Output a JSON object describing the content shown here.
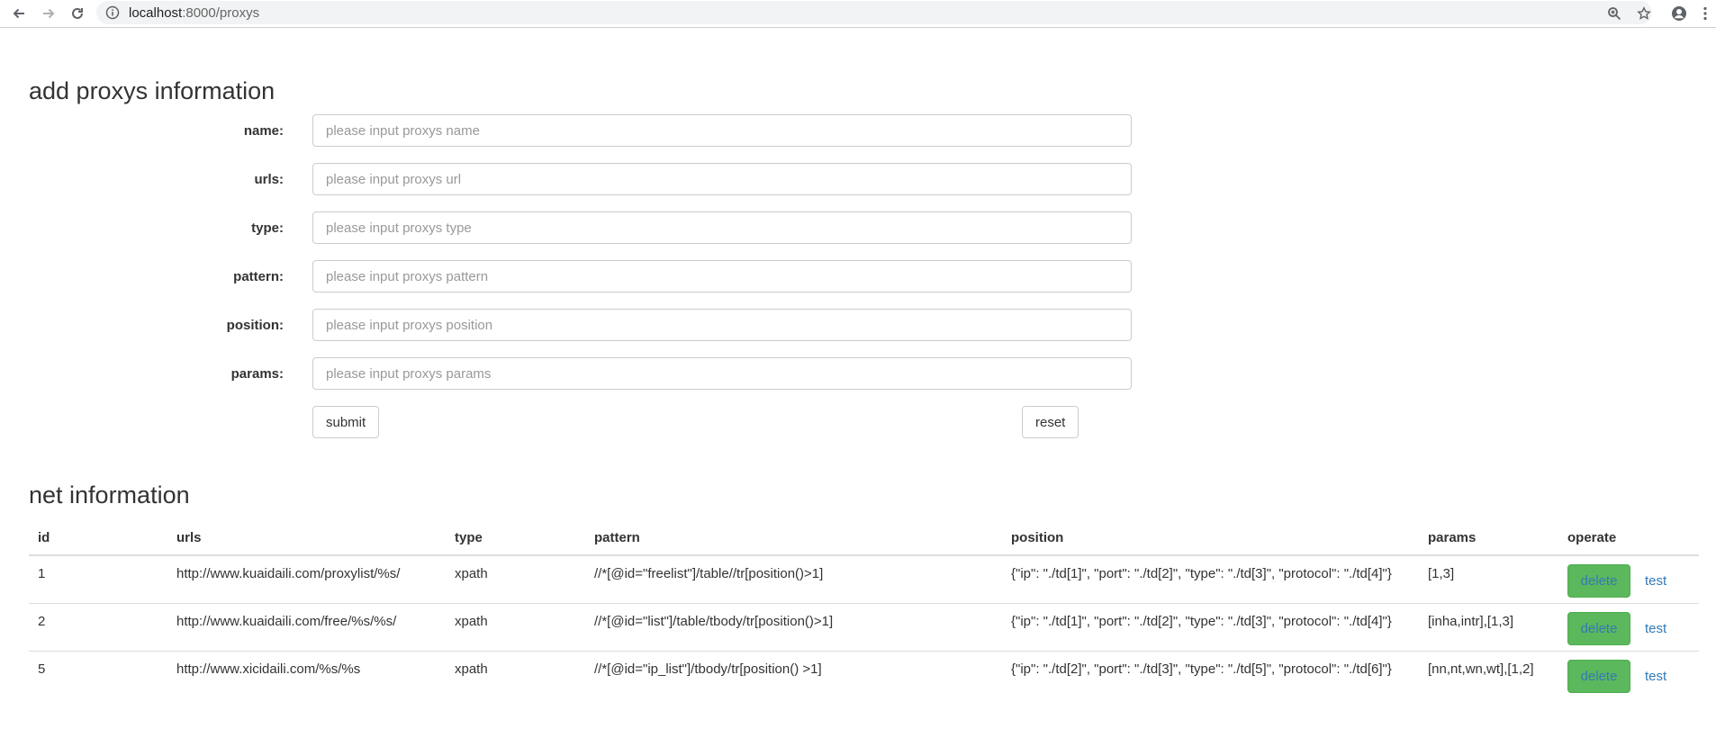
{
  "browser": {
    "url_host": "localhost",
    "url_path": ":8000/proxys"
  },
  "add_section": {
    "title": "add proxys information"
  },
  "form": {
    "fields": [
      {
        "label": "name:",
        "placeholder": "please input proxys name"
      },
      {
        "label": "urls:",
        "placeholder": "please input proxys url"
      },
      {
        "label": "type:",
        "placeholder": "please input proxys type"
      },
      {
        "label": "pattern:",
        "placeholder": "please input proxys pattern"
      },
      {
        "label": "position:",
        "placeholder": "please input proxys position"
      },
      {
        "label": "params:",
        "placeholder": "please input proxys params"
      }
    ],
    "submit_label": "submit",
    "reset_label": "reset"
  },
  "net_section": {
    "title": "net information"
  },
  "table": {
    "headers": [
      "id",
      "urls",
      "type",
      "pattern",
      "position",
      "params",
      "operate"
    ],
    "rows": [
      {
        "id": "1",
        "urls": "http://www.kuaidaili.com/proxylist/%s/",
        "type": "xpath",
        "pattern": "//*[@id=\"freelist\"]/table//tr[position()>1]",
        "position": "{\"ip\": \"./td[1]\", \"port\": \"./td[2]\", \"type\": \"./td[3]\", \"protocol\": \"./td[4]\"}",
        "params": "[1,3]",
        "delete_label": "delete",
        "test_label": "test"
      },
      {
        "id": "2",
        "urls": "http://www.kuaidaili.com/free/%s/%s/",
        "type": "xpath",
        "pattern": "//*[@id=\"list\"]/table/tbody/tr[position()>1]",
        "position": "{\"ip\": \"./td[1]\", \"port\": \"./td[2]\", \"type\": \"./td[3]\", \"protocol\": \"./td[4]\"}",
        "params": "[inha,intr],[1,3]",
        "delete_label": "delete",
        "test_label": "test"
      },
      {
        "id": "5",
        "urls": "http://www.xicidaili.com/%s/%s",
        "type": "xpath",
        "pattern": "//*[@id=\"ip_list\"]/tbody/tr[position() >1]",
        "position": "{\"ip\": \"./td[2]\", \"port\": \"./td[3]\", \"type\": \"./td[5]\", \"protocol\": \"./td[6]\"}",
        "params": "[nn,nt,wn,wt],[1,2]",
        "delete_label": "delete",
        "test_label": "test"
      }
    ]
  },
  "icons": {
    "back": "arrow-left-icon",
    "forward": "arrow-right-icon",
    "reload": "reload-icon",
    "info": "info-icon",
    "zoom": "zoom-icon",
    "star": "star-icon",
    "account": "account-icon",
    "menu": "kebab-menu-icon"
  },
  "colors": {
    "delete_button_bg": "#5cb85c",
    "link": "#337ab7",
    "input_border": "#cccccc"
  }
}
